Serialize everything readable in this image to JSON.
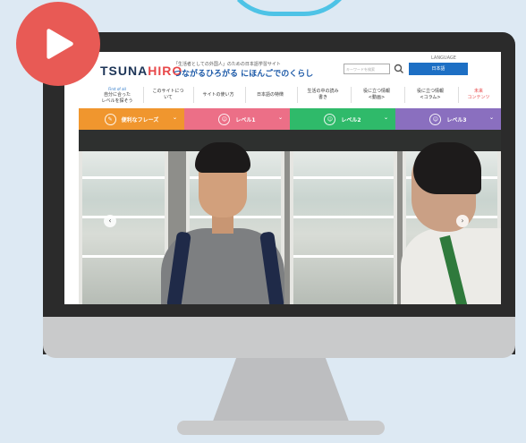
{
  "header": {
    "logo_a": "TSUNA",
    "logo_b": "HIRO",
    "tagline": "「生活者としての外国人」のための日本語学習サイト",
    "subtitle": "つながるひろがる にほんごでのくらし",
    "language_label": "LANGUAGE",
    "language_value": "日本語",
    "search_placeholder": "キーワードを検索"
  },
  "nav": {
    "items": [
      {
        "note": "First of all",
        "label": "自分に合った\nレベルを探そう"
      },
      {
        "label": "このサイトにつ\nいて"
      },
      {
        "label": "サイトの使い方"
      },
      {
        "label": "日本語の特徴"
      },
      {
        "label": "生活の中の読み\n書き"
      },
      {
        "label": "役に立つ情報\n<動画>"
      },
      {
        "label": "役に立つ情報\n<コラム>"
      },
      {
        "label": "未来\nコンテンツ"
      }
    ]
  },
  "categories": [
    {
      "label": "便利なフレーズ",
      "color": "#f0962e"
    },
    {
      "label": "レベル1",
      "color": "#ec6f87"
    },
    {
      "label": "レベル2",
      "color": "#2fba6a"
    },
    {
      "label": "レベル3",
      "color": "#8a6fbf"
    }
  ],
  "colors": {
    "background": "#dde9f3",
    "play_badge": "#e85a55",
    "accent_blue": "#1d6fc4"
  }
}
